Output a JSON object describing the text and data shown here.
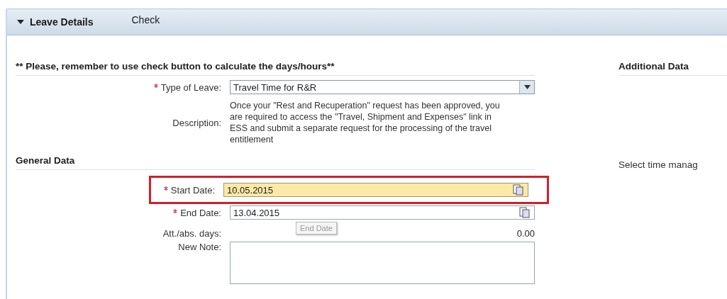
{
  "header": {
    "title": "Leave Details",
    "expanded": true,
    "action": "Check"
  },
  "notice": "** Please, remember to use check button to calculate the days/hours**",
  "leave_type": {
    "label": "Type of Leave:",
    "required": true,
    "value": "Travel Time for R&R"
  },
  "description": {
    "label": "Description:",
    "text": "Once your \"Rest and Recuperation\" request has been approved, you are required to access the \"Travel, Shipment and Expenses\" link in ESS and submit a separate request for the processing of the travel entitlement"
  },
  "general_data": {
    "title": "General Data",
    "fields": [
      {
        "kind": "date",
        "label": "Start Date:",
        "required": true,
        "value": "10.05.2015",
        "focused": true,
        "highlighted": true
      },
      {
        "kind": "date",
        "label": "End Date:",
        "required": true,
        "value": "13.04.2015",
        "focused": false,
        "highlighted": false,
        "tooltip": "End Date"
      },
      {
        "kind": "readonly",
        "label": "Att./abs. days:",
        "value": "0.00"
      },
      {
        "kind": "note",
        "label": "New Note:"
      }
    ]
  },
  "additional_data": {
    "title": "Additional Data",
    "text": "Select time manag"
  }
}
